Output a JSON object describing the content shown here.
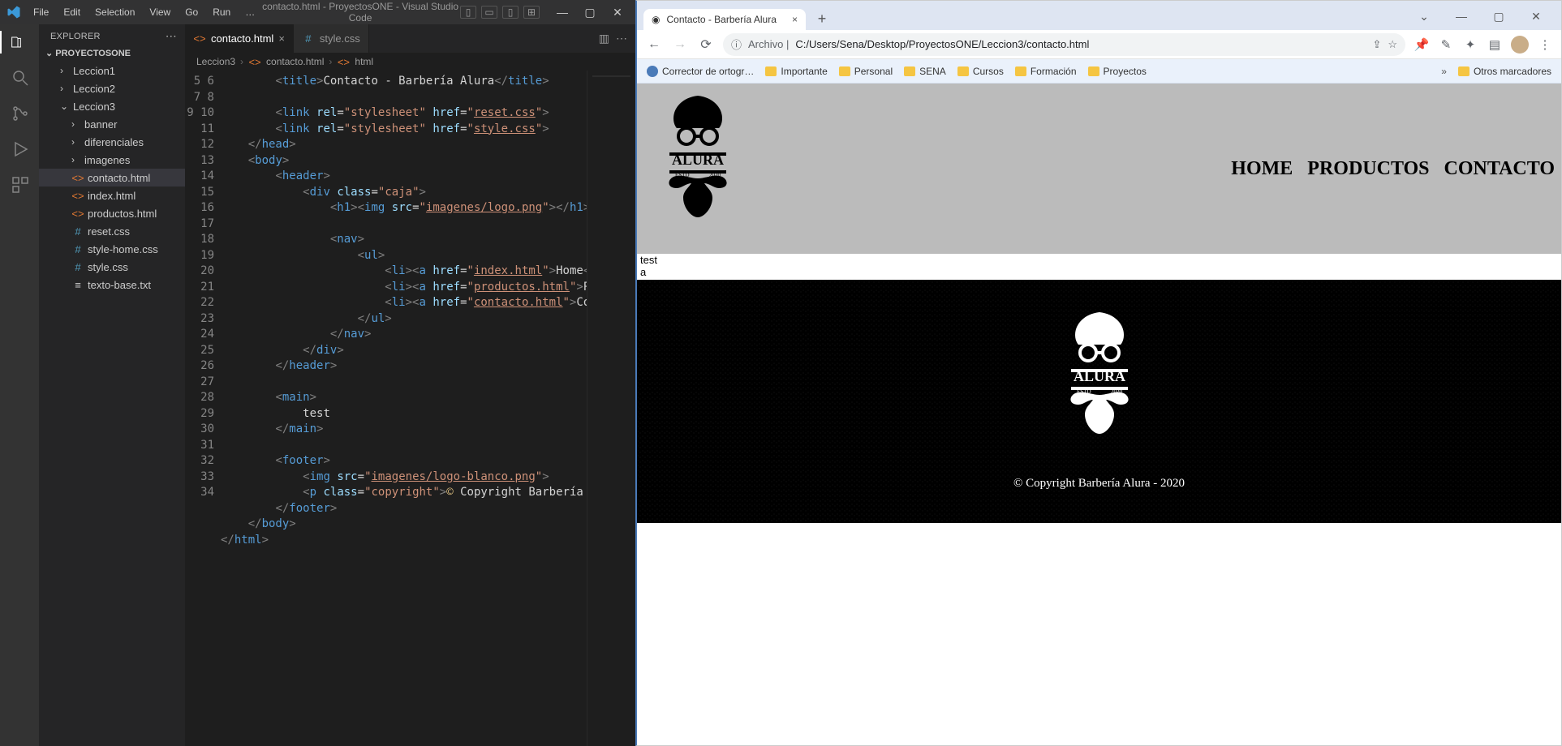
{
  "vscode": {
    "menu": [
      "File",
      "Edit",
      "Selection",
      "View",
      "Go",
      "Run",
      "…"
    ],
    "window_title": "contacto.html - ProyectosONE - Visual Studio Code",
    "explorer_label": "EXPLORER",
    "project_name": "PROYECTOSONE",
    "tree": {
      "leccion1": "Leccion1",
      "leccion2": "Leccion2",
      "leccion3": "Leccion3",
      "banner": "banner",
      "diferenciales": "diferenciales",
      "imagenes": "imagenes",
      "contacto": "contacto.html",
      "index": "index.html",
      "productos": "productos.html",
      "reset": "reset.css",
      "stylehome": "style-home.css",
      "stylecss": "style.css",
      "textobase": "texto-base.txt"
    },
    "tabs": {
      "t1": "contacto.html",
      "t2": "style.css"
    },
    "breadcrumb": {
      "p1": "Leccion3",
      "p2": "contacto.html",
      "p3": "html"
    },
    "line_numbers": [
      "5",
      "6",
      "7",
      "8",
      "9",
      "10",
      "11",
      "12",
      "13",
      "14",
      "15",
      "16",
      "17",
      "18",
      "19",
      "20",
      "21",
      "22",
      "23",
      "24",
      "25",
      "26",
      "27",
      "28",
      "29",
      "30",
      "31",
      "32",
      "33",
      "34"
    ],
    "code": {
      "l5": {
        "title_text": "Contacto - Barbería Alura"
      },
      "l7": {
        "rel": "\"stylesheet\"",
        "href": "\"",
        "file": "reset.css",
        "closeq": "\""
      },
      "l8": {
        "rel": "\"stylesheet\"",
        "href": "\"",
        "file": "style.css",
        "closeq": "\""
      },
      "l12": {
        "class": "\"caja\""
      },
      "l13": {
        "src": "\"",
        "file": "imagenes/logo.png",
        "closeq": "\""
      },
      "l17": {
        "href": "\"",
        "file": "index.html",
        "closeq": "\"",
        "text": "Home"
      },
      "l18": {
        "href": "\"",
        "file": "productos.html",
        "closeq": "\"",
        "text": "Produc"
      },
      "l19": {
        "href": "\"",
        "file": "contacto.html",
        "closeq": "\"",
        "text": "Contact"
      },
      "l26": {
        "text": "test"
      },
      "l30": {
        "src": "\"",
        "file": "imagenes/logo-blanco.png",
        "closeq": "\""
      },
      "l31": {
        "class": "\"copyright\"",
        "amp": "&copy;",
        "text": " Copyright Barbería"
      }
    }
  },
  "browser": {
    "tab_title": "Contacto - Barbería Alura",
    "omnibox_prefix": "Archivo |",
    "url": "C:/Users/Sena/Desktop/ProyectosONE/Leccion3/contacto.html",
    "bookmarks": {
      "spell": "Corrector de ortogr…",
      "importante": "Importante",
      "personal": "Personal",
      "sena": "SENA",
      "cursos": "Cursos",
      "formacion": "Formación",
      "proyectos": "Proyectos",
      "otros": "Otros marcadores"
    },
    "site": {
      "brand": "ALURA",
      "estd": "ESTD",
      "year": "2020",
      "nav_home": "HOME",
      "nav_productos": "PRODUCTOS",
      "nav_contacto": "CONTACTO",
      "body_test": "test",
      "body_a": "a",
      "copyright": "© Copyright Barbería Alura - 2020"
    }
  }
}
